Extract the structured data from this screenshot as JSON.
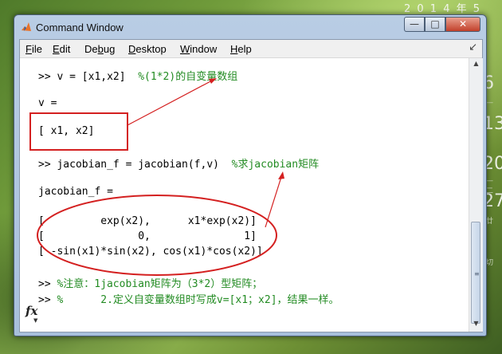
{
  "desktop": {
    "gadget_top": "2 0 1 4 年 5",
    "gadget_numbers": [
      "6",
      "13",
      "20",
      "27"
    ],
    "gadget_small": [
      "—",
      "— 二",
      "廿",
      "切"
    ]
  },
  "window": {
    "title": "Command Window",
    "buttons": {
      "minimize": "—",
      "maximize": "□",
      "close": "✕"
    }
  },
  "menubar": {
    "items": [
      {
        "key": "F",
        "rest": "ile"
      },
      {
        "key": "E",
        "rest": "dit"
      },
      {
        "pre": "De",
        "key": "b",
        "rest": "ug"
      },
      {
        "key": "D",
        "rest": "esktop"
      },
      {
        "key": "W",
        "rest": "indow"
      },
      {
        "key": "H",
        "rest": "elp"
      }
    ],
    "dock_icon": "↙"
  },
  "command": {
    "lines": [
      {
        "code": ">> v = [x1,x2]  ",
        "comment": "%(1*2)的自变量数组"
      },
      {
        "code": "v ="
      },
      {
        "code": "[ x1, x2]"
      },
      {
        "code": ">> jacobian_f = jacobian(f,v)  ",
        "comment": "%求jacobian矩阵"
      },
      {
        "code": "jacobian_f ="
      },
      {
        "code": "[         exp(x2),      x1*exp(x2)]"
      },
      {
        "code": "[               0,               1]"
      },
      {
        "code": "[ -sin(x1)*sin(x2), cos(x1)*cos(x2)]"
      },
      {
        "code": ">> ",
        "comment": "%注意：1jacobian矩阵为（3*2）型矩阵；"
      },
      {
        "code": ">> ",
        "comment": "%      2.定义自变量数组时写成v=[x1；x2]，结果一样。"
      }
    ],
    "fx_label": "fx",
    "fx_arrow": "▼"
  },
  "scrollbar": {
    "up": "▲",
    "down": "▼",
    "grip": "≡"
  },
  "colors": {
    "comment": "#228b22",
    "annotation": "#d42020",
    "close_button": "#c2402a"
  }
}
